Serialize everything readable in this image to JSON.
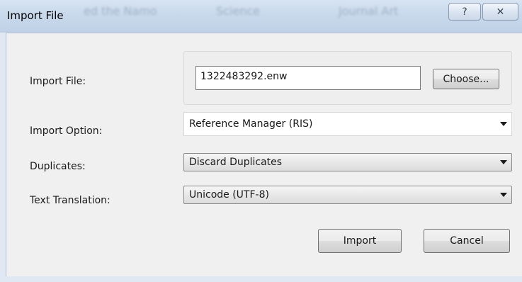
{
  "window": {
    "title": "Import File",
    "background_blur_text": [
      "ed the Namo",
      "Science",
      "Journal Art"
    ],
    "help_glyph": "?",
    "close_glyph": "✕"
  },
  "form": {
    "import_file": {
      "label": "Import File:",
      "value": "1322483292.enw",
      "choose_label": "Choose..."
    },
    "import_option": {
      "label": "Import Option:",
      "selected": "Reference Manager (RIS)"
    },
    "duplicates": {
      "label": "Duplicates:",
      "selected": "Discard Duplicates"
    },
    "text_translation": {
      "label": "Text Translation:",
      "selected": "Unicode (UTF-8)"
    }
  },
  "buttons": {
    "import_label": "Import",
    "cancel_label": "Cancel"
  },
  "colors": {
    "titlebar": "#c9d9ec",
    "dialog_bg": "#f0f0f0"
  }
}
